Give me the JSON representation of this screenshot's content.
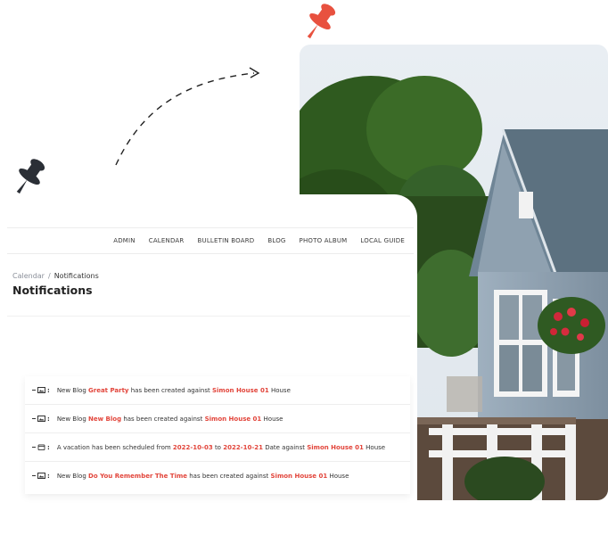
{
  "nav": {
    "items": [
      "ADMIN",
      "CALENDAR",
      "BULLETIN BOARD",
      "BLOG",
      "PHOTO ALBUM",
      "LOCAL GUIDE"
    ]
  },
  "breadcrumb": {
    "parent": "Calendar",
    "separator": "/",
    "current": "Notifications"
  },
  "page": {
    "title": "Notifications"
  },
  "notifications": [
    {
      "icon": "image-icon",
      "pre": "New Blog",
      "link1": "Great Party",
      "mid": "has been created against",
      "link2": "Simon House 01",
      "post": "House"
    },
    {
      "icon": "image-icon",
      "pre": "New Blog",
      "link1": "New Blog",
      "mid": "has been created against",
      "link2": "Simon House 01",
      "post": "House"
    },
    {
      "icon": "calendar-icon",
      "pre": "A vacation has been scheduled from",
      "link1": "2022-10-03",
      "mid1": "to",
      "link2": "2022-10-21",
      "mid2": "Date against",
      "link3": "Simon House 01",
      "post": "House"
    },
    {
      "icon": "image-icon",
      "pre": "New Blog",
      "link1": "Do You Remember The Time",
      "mid": "has been created against",
      "link2": "Simon House 01",
      "post": "House"
    }
  ],
  "colors": {
    "accent": "#e2453b",
    "pin_red": "#e8513f",
    "pin_dark": "#2b2f36"
  }
}
